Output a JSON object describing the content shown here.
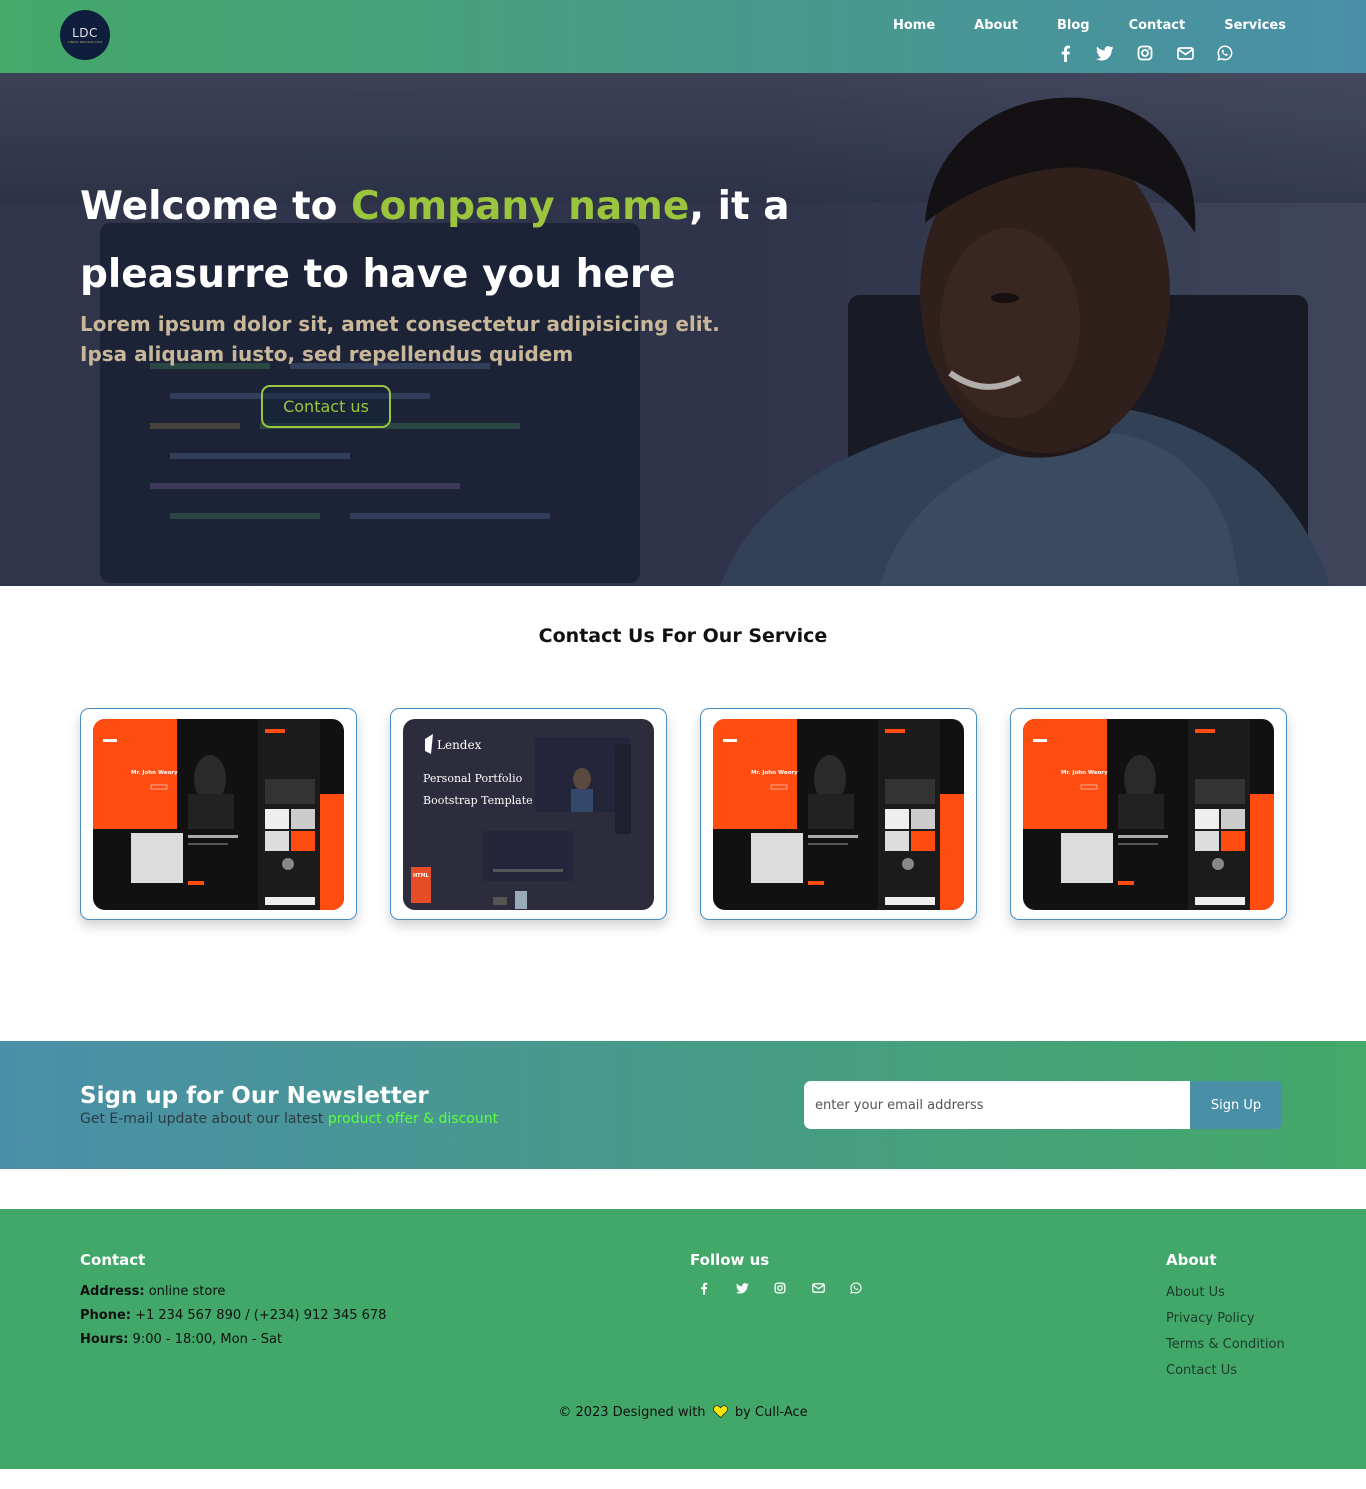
{
  "header": {
    "logo_text": "LDC",
    "logo_tagline": "LINDA DESIGN.COM",
    "nav": [
      {
        "label": "Home"
      },
      {
        "label": "About"
      },
      {
        "label": "Blog"
      },
      {
        "label": "Contact"
      },
      {
        "label": "Services"
      }
    ],
    "social_icons": [
      "facebook-icon",
      "twitter-icon",
      "instagram-icon",
      "mail-icon",
      "whatsapp-icon"
    ]
  },
  "hero": {
    "title_part1": "Welcome to ",
    "title_accent": "Company name",
    "title_part2": ", it a pleasurre to have you here",
    "subtitle": "Lorem ipsum dolor sit, amet consectetur adipisicing elit. Ipsa aliquam iusto, sed repellendus quidem",
    "cta_label": "Contact us"
  },
  "services": {
    "title": "Contact Us For Our Service",
    "cards": [
      {
        "kind": "portfolio-orange",
        "heading": "Mr. John Weory"
      },
      {
        "kind": "lendex",
        "brand": "Lendex",
        "line1": "Personal Portfolio",
        "line2": "Bootstrap Template",
        "badge": "HTML"
      },
      {
        "kind": "portfolio-orange",
        "heading": "Mr. John Weory"
      },
      {
        "kind": "portfolio-orange",
        "heading": "Mr. John Weory"
      }
    ]
  },
  "newsletter": {
    "title": "Sign up for Our Newsletter",
    "subtitle": "Get E-mail update about our latest ",
    "subtitle_highlight": "product offer & discount",
    "email_placeholder": "enter your email addrerss",
    "button_label": "Sign Up"
  },
  "footer": {
    "contact": {
      "heading": "Contact",
      "address_label": "Address:",
      "address_value": " online store",
      "phone_label": "Phone:",
      "phone_value": " +1 234 567 890 / (+234) 912 345 678",
      "hours_label": "Hours:",
      "hours_value": " 9:00 - 18:00, Mon - Sat"
    },
    "follow": {
      "heading": "Follow us",
      "icons": [
        "facebook-icon",
        "twitter-icon",
        "instagram-icon",
        "mail-icon",
        "whatsapp-icon"
      ]
    },
    "about": {
      "heading": "About",
      "links": [
        "About Us",
        "Privacy Policy",
        "Terms & Condition",
        "Contact Us"
      ]
    },
    "copyright_prefix": "© 2023 Designed with",
    "copyright_suffix": "by Cull-Ace"
  },
  "colors": {
    "accent_green": "#9bc53d",
    "header_start": "#43a868",
    "header_end": "#4a8fa8",
    "footer_bg": "#41a86a",
    "highlight": "#5dff3a"
  }
}
